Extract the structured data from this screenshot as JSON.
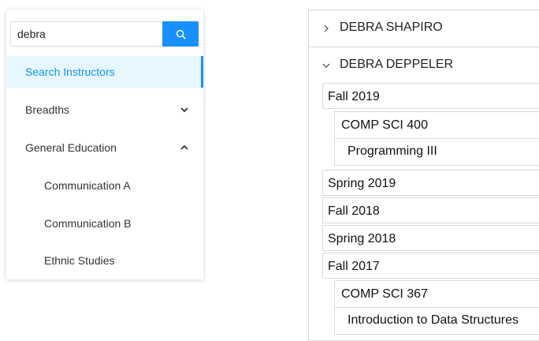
{
  "search": {
    "value": "debra",
    "button": "search-icon"
  },
  "menu": {
    "items": [
      {
        "label": "Search Instructors",
        "selected": true
      },
      {
        "label": "Breadths",
        "expanded": false
      },
      {
        "label": "General Education",
        "expanded": true
      },
      {
        "label": "Communication A"
      },
      {
        "label": "Communication B"
      },
      {
        "label": "Ethnic Studies"
      }
    ]
  },
  "instructors": [
    {
      "name": "DEBRA SHAPIRO",
      "expanded": false
    },
    {
      "name": "DEBRA DEPPELER",
      "expanded": true
    }
  ],
  "terms": [
    {
      "label": "Fall 2019",
      "course": {
        "code": "COMP SCI 400",
        "title": "Programming III"
      }
    },
    {
      "label": "Spring 2019"
    },
    {
      "label": "Fall 2018"
    },
    {
      "label": "Spring 2018"
    },
    {
      "label": "Fall 2017",
      "course": {
        "code": "COMP SCI 367",
        "title": "Introduction to Data Structures"
      }
    }
  ],
  "colors": {
    "accent": "#1890ff",
    "selected_bg": "#e6f7ff",
    "border": "#d9d9d9"
  }
}
